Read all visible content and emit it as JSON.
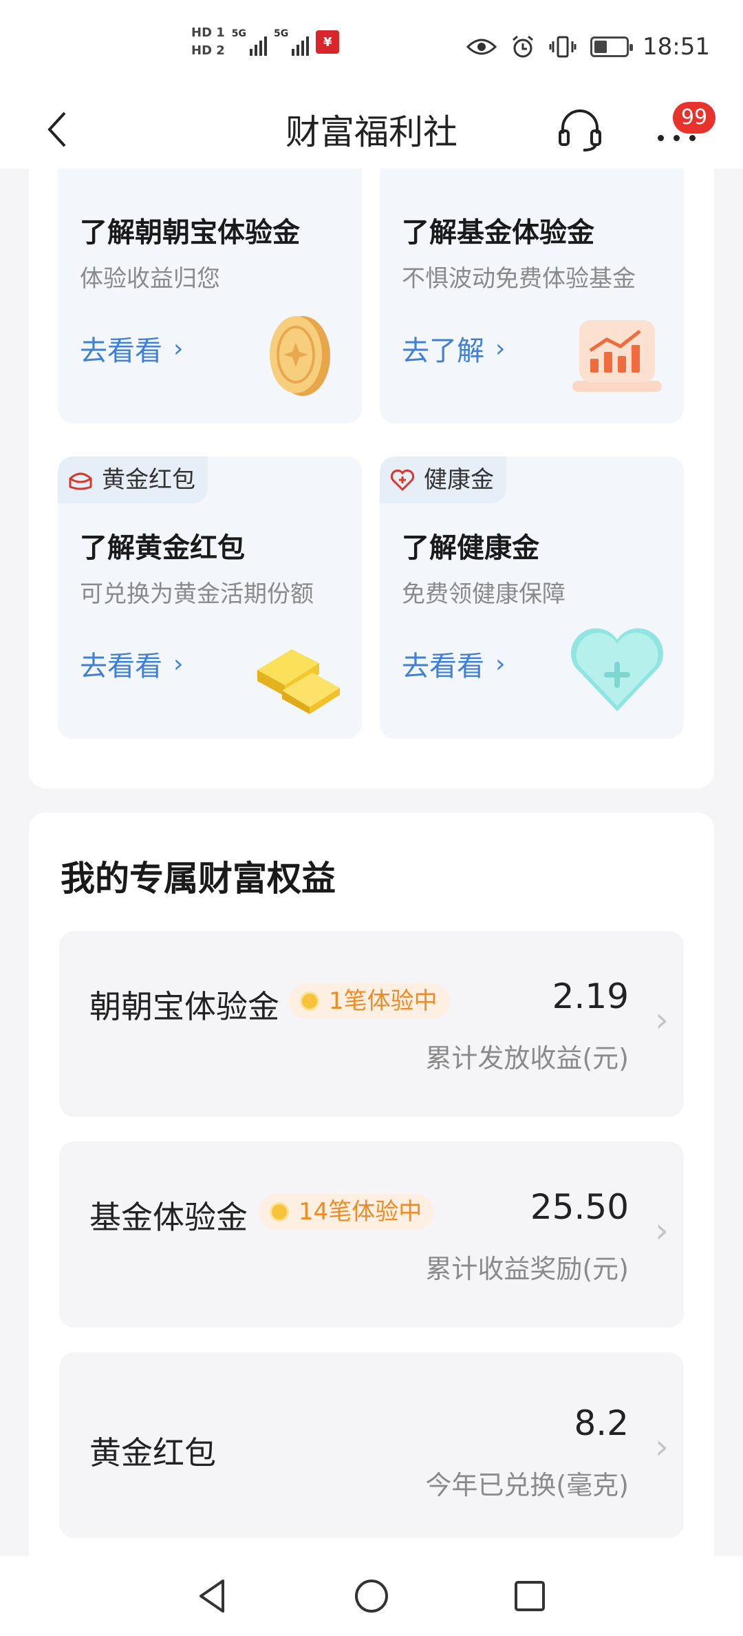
{
  "status_bar": {
    "hd1": "HD 1",
    "hd2": "HD 2",
    "net1": "5G",
    "net2": "5G",
    "time": "18:51",
    "battery_level": 0.35
  },
  "nav": {
    "title": "财富福利社",
    "badge_count": "99"
  },
  "cards": [
    {
      "title": "了解朝朝宝体验金",
      "subtitle": "体验收益归您",
      "link": "去看看",
      "icon": "gold-coin-icon"
    },
    {
      "title": "了解基金体验金",
      "subtitle": "不惧波动免费体验基金",
      "link": "去了解",
      "icon": "chart-up-icon"
    },
    {
      "tag": "黄金红包",
      "title": "了解黄金红包",
      "subtitle": "可兑换为黄金活期份额",
      "link": "去看看",
      "icon": "gold-bar-icon"
    },
    {
      "tag": "健康金",
      "title": "了解健康金",
      "subtitle": "免费领健康保障",
      "link": "去看看",
      "icon": "heart-plus-icon"
    }
  ],
  "benefits": {
    "title": "我的专属财富权益",
    "items": [
      {
        "name": "朝朝宝体验金",
        "pill": "1笔体验中",
        "value": "2.19",
        "desc": "累计发放收益(元)"
      },
      {
        "name": "基金体验金",
        "pill": "14笔体验中",
        "value": "25.50",
        "desc": "累计收益奖励(元)"
      },
      {
        "name": "黄金红包",
        "value": "8.2",
        "desc": "今年已兑换(毫克)"
      }
    ]
  },
  "colors": {
    "accent_link": "#3f7fd6",
    "pill_text": "#f08a24",
    "badge": "#e8332c"
  }
}
